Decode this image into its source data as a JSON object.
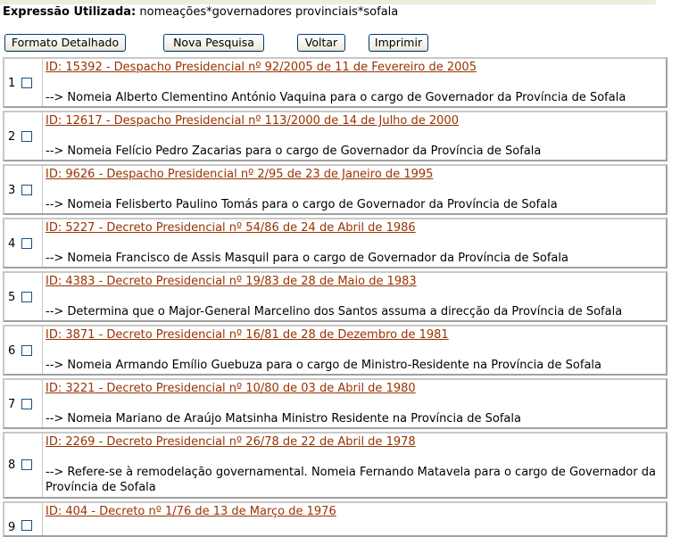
{
  "search": {
    "expression_label": "Expressão Utilizada:",
    "expression_value": "nomeações*governadores provinciais*sofala"
  },
  "toolbar": {
    "detailed_label": "Formato Detalhado",
    "new_search_label": "Nova Pesquisa",
    "back_label": "Voltar",
    "print_label": "Imprimir"
  },
  "results": [
    {
      "num": "1",
      "title": "ID: 15392 - Despacho Presidencial nº 92/2005 de 11 de Fevereiro de 2005",
      "desc": "--> Nomeia Alberto Clementino António Vaquina para o cargo de Governador da Província de Sofala"
    },
    {
      "num": "2",
      "title": "ID: 12617 - Despacho Presidencial nº 113/2000 de 14 de Julho de 2000",
      "desc": "--> Nomeia Felício Pedro Zacarias para o cargo de Governador da Província de Sofala"
    },
    {
      "num": "3",
      "title": "ID: 9626 - Despacho Presidencial nº 2/95 de 23 de Janeiro de 1995",
      "desc": "--> Nomeia Felisberto Paulino Tomás para o cargo de Governador da Província de Sofala"
    },
    {
      "num": "4",
      "title": "ID: 5227 - Decreto Presidencial nº 54/86 de 24 de Abril de 1986",
      "desc": "--> Nomeia Francisco de Assis Masquil para o cargo de Governador da Província de Sofala"
    },
    {
      "num": "5",
      "title": "ID: 4383 - Decreto Presidencial nº 19/83 de 28 de Maio de 1983",
      "desc": "--> Determina que o Major-General Marcelino dos Santos assuma a direcção da Província de Sofala"
    },
    {
      "num": "6",
      "title": "ID: 3871 - Decreto Presidencial nº 16/81 de 28 de Dezembro de 1981",
      "desc": "--> Nomeia Armando Emílio Guebuza para o cargo de Ministro-Residente na Província de Sofala"
    },
    {
      "num": "7",
      "title": "ID: 3221 - Decreto Presidencial nº 10/80 de 03 de Abril de 1980",
      "desc": "--> Nomeia Mariano de Araújo Matsinha Ministro Residente na Província de Sofala"
    },
    {
      "num": "8",
      "title": "ID: 2269 - Decreto Presidencial nº 26/78 de 22 de Abril de 1978",
      "desc": "--> Refere-se à remodelação governamental. Nomeia Fernando Matavela para o cargo de Governador da Província de Sofala"
    },
    {
      "num": "9",
      "title": "ID: 404 - Decreto nº 1/76 de 13 de Março de 1976",
      "desc": ""
    }
  ]
}
